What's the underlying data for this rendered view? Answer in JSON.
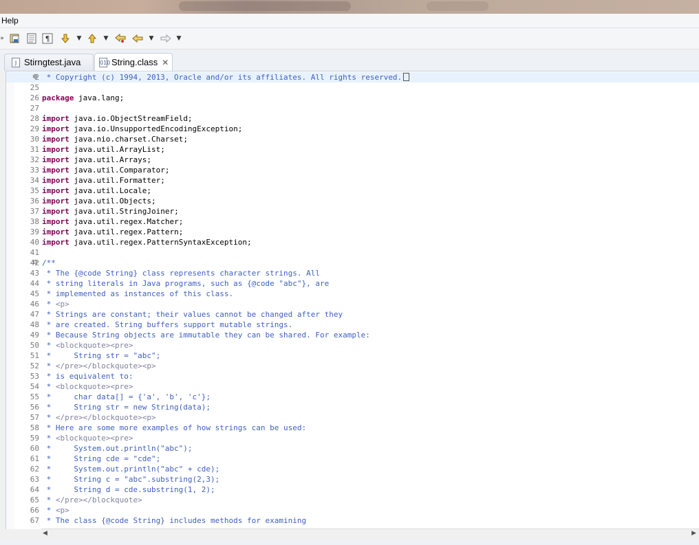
{
  "menu": {
    "help_label": "Help"
  },
  "toolbar": {
    "icons": [
      "chevron-icon",
      "save-all-icon",
      "show-whitespace-icon",
      "pilcrow-icon",
      "next-annotation-icon",
      "dropdown-icon",
      "previous-annotation-icon",
      "dropdown-icon",
      "last-edit-icon",
      "back-icon",
      "dropdown-icon",
      "forward-icon",
      "dropdown-icon"
    ]
  },
  "tabs": [
    {
      "label": "Stirngtest.java",
      "icon": "java-file-icon",
      "active": false
    },
    {
      "label": "String.class",
      "icon": "class-file-icon",
      "active": true,
      "close": "✕"
    }
  ],
  "editor": {
    "lines": [
      {
        "n": "2",
        "fold": "⊕",
        "hl": true,
        "html": "<span class=\"cm\"> * Copyright (c) 1994, 2013, Oracle and/or its affiliates. All rights reserved.</span><span class=\"collapsed-box\"></span>"
      },
      {
        "n": "25",
        "html": ""
      },
      {
        "n": "26",
        "html": "<span class=\"kw\">package</span> java.lang;"
      },
      {
        "n": "27",
        "html": ""
      },
      {
        "n": "28",
        "html": "<span class=\"kw\">import</span> java.io.ObjectStreamField;"
      },
      {
        "n": "29",
        "html": "<span class=\"kw\">import</span> java.io.UnsupportedEncodingException;"
      },
      {
        "n": "30",
        "html": "<span class=\"kw\">import</span> java.nio.charset.Charset;"
      },
      {
        "n": "31",
        "html": "<span class=\"kw\">import</span> java.util.ArrayList;"
      },
      {
        "n": "32",
        "html": "<span class=\"kw\">import</span> java.util.Arrays;"
      },
      {
        "n": "33",
        "html": "<span class=\"kw\">import</span> java.util.Comparator;"
      },
      {
        "n": "34",
        "html": "<span class=\"kw\">import</span> java.util.Formatter;"
      },
      {
        "n": "35",
        "html": "<span class=\"kw\">import</span> java.util.Locale;"
      },
      {
        "n": "36",
        "html": "<span class=\"kw\">import</span> java.util.Objects;"
      },
      {
        "n": "37",
        "html": "<span class=\"kw\">import</span> java.util.StringJoiner;"
      },
      {
        "n": "38",
        "html": "<span class=\"kw\">import</span> java.util.regex.Matcher;"
      },
      {
        "n": "39",
        "html": "<span class=\"kw\">import</span> java.util.regex.Pattern;"
      },
      {
        "n": "40",
        "html": "<span class=\"kw\">import</span> java.util.regex.PatternSyntaxException;"
      },
      {
        "n": "41",
        "html": ""
      },
      {
        "n": "42",
        "fold": "⊖",
        "html": "<span class=\"cm\">/**</span>"
      },
      {
        "n": "43",
        "html": "<span class=\"cm\"> * The {@code String} class represents character strings. All</span>"
      },
      {
        "n": "44",
        "html": "<span class=\"cm\"> * string literals in Java programs, such as {@code \"abc\"}, are</span>"
      },
      {
        "n": "45",
        "html": "<span class=\"cm\"> * implemented as instances of this class.</span>"
      },
      {
        "n": "46",
        "html": "<span class=\"cm\"> * </span><span class=\"ht\">&lt;p&gt;</span>"
      },
      {
        "n": "47",
        "html": "<span class=\"cm\"> * Strings are constant; their values cannot be changed after they</span>"
      },
      {
        "n": "48",
        "html": "<span class=\"cm\"> * are created. String buffers support mutable strings.</span>"
      },
      {
        "n": "49",
        "html": "<span class=\"cm\"> * Because String objects are immutable they can be shared. For example:</span>"
      },
      {
        "n": "50",
        "html": "<span class=\"cm\"> * </span><span class=\"ht\">&lt;blockquote&gt;&lt;pre&gt;</span>"
      },
      {
        "n": "51",
        "html": "<span class=\"cm\"> *     String str = \"abc\";</span>"
      },
      {
        "n": "52",
        "html": "<span class=\"cm\"> * </span><span class=\"ht\">&lt;/pre&gt;&lt;/blockquote&gt;&lt;p&gt;</span>"
      },
      {
        "n": "53",
        "html": "<span class=\"cm\"> * is equivalent to:</span>"
      },
      {
        "n": "54",
        "html": "<span class=\"cm\"> * </span><span class=\"ht\">&lt;blockquote&gt;&lt;pre&gt;</span>"
      },
      {
        "n": "55",
        "html": "<span class=\"cm\"> *     char data[] = {'a', 'b', 'c'};</span>"
      },
      {
        "n": "56",
        "html": "<span class=\"cm\"> *     String str = new String(data);</span>"
      },
      {
        "n": "57",
        "html": "<span class=\"cm\"> * </span><span class=\"ht\">&lt;/pre&gt;&lt;/blockquote&gt;&lt;p&gt;</span>"
      },
      {
        "n": "58",
        "html": "<span class=\"cm\"> * Here are some more examples of how strings can be used:</span>"
      },
      {
        "n": "59",
        "html": "<span class=\"cm\"> * </span><span class=\"ht\">&lt;blockquote&gt;&lt;pre&gt;</span>"
      },
      {
        "n": "60",
        "html": "<span class=\"cm\"> *     System.out.println(\"abc\");</span>"
      },
      {
        "n": "61",
        "html": "<span class=\"cm\"> *     String cde = \"cde\";</span>"
      },
      {
        "n": "62",
        "html": "<span class=\"cm\"> *     System.out.println(\"abc\" + cde);</span>"
      },
      {
        "n": "63",
        "html": "<span class=\"cm\"> *     String c = \"abc\".substring(2,3);</span>"
      },
      {
        "n": "64",
        "html": "<span class=\"cm\"> *     String d = cde.substring(1, 2);</span>"
      },
      {
        "n": "65",
        "html": "<span class=\"cm\"> * </span><span class=\"ht\">&lt;/pre&gt;&lt;/blockquote&gt;</span>"
      },
      {
        "n": "66",
        "html": "<span class=\"cm\"> * </span><span class=\"ht\">&lt;p&gt;</span>"
      },
      {
        "n": "67",
        "html": "<span class=\"cm\"> * The class {@code String} includes methods for examining</span>"
      }
    ]
  },
  "scrollbar": {
    "left_arrow": "◀",
    "right_arrow": "▶"
  },
  "colors": {
    "keyword": "#7f0055",
    "comment": "#3f5fbf",
    "html_tag": "#7f7f9f",
    "line_highlight": "#e8f2fe"
  }
}
